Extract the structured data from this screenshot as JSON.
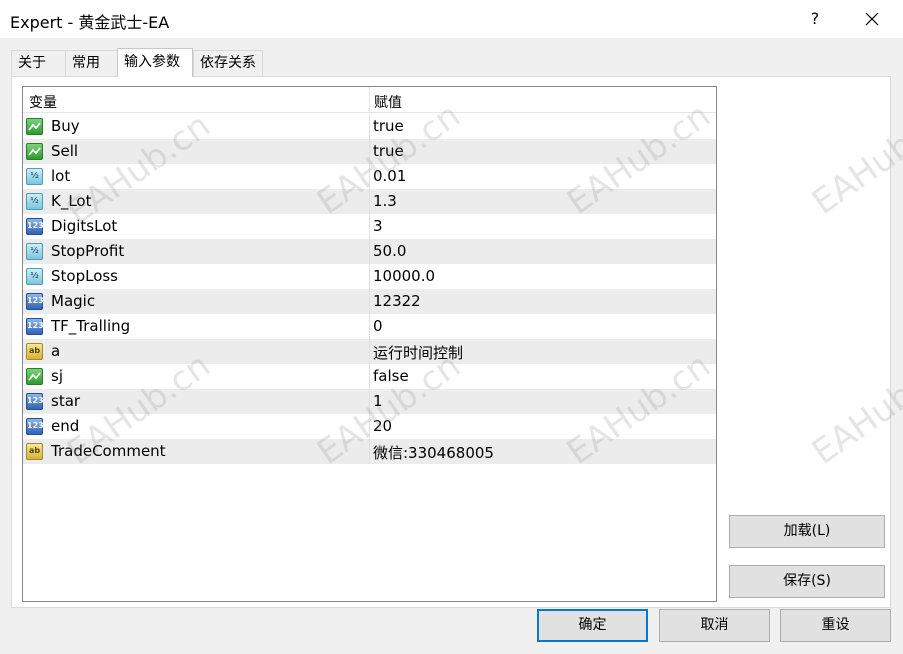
{
  "window": {
    "title": "Expert - 黄金武士-EA",
    "help": "?"
  },
  "tabs": [
    {
      "label": "关于"
    },
    {
      "label": "常用"
    },
    {
      "label": "输入参数"
    },
    {
      "label": "依存关系"
    }
  ],
  "table": {
    "headers": {
      "variable": "变量",
      "value": "赋值"
    },
    "rows": [
      {
        "name": "Buy",
        "value": "true",
        "icon": "bool-icon"
      },
      {
        "name": "Sell",
        "value": "true",
        "icon": "bool-icon"
      },
      {
        "name": "lot",
        "value": "0.01",
        "icon": "double-icon"
      },
      {
        "name": "K_Lot",
        "value": "1.3",
        "icon": "double-icon"
      },
      {
        "name": "DigitsLot",
        "value": "3",
        "icon": "int-icon"
      },
      {
        "name": "StopProfit",
        "value": "50.0",
        "icon": "double-icon"
      },
      {
        "name": "StopLoss",
        "value": "10000.0",
        "icon": "double-icon"
      },
      {
        "name": "Magic",
        "value": "12322",
        "icon": "int-icon"
      },
      {
        "name": "TF_Tralling",
        "value": "0",
        "icon": "int-icon"
      },
      {
        "name": "a",
        "value": "运行时间控制",
        "icon": "string-icon"
      },
      {
        "name": "sj",
        "value": "false",
        "icon": "bool-icon"
      },
      {
        "name": "star",
        "value": "1",
        "icon": "int-icon"
      },
      {
        "name": "end",
        "value": "20",
        "icon": "int-icon"
      },
      {
        "name": "TradeComment",
        "value": "微信:330468005",
        "icon": "string-icon"
      }
    ]
  },
  "icon_glyphs": {
    "double": "½",
    "int": "123",
    "string": "ab"
  },
  "buttons": {
    "load": "加载(L)",
    "save": "保存(S)",
    "ok": "确定",
    "cancel": "取消",
    "reset": "重设"
  },
  "watermark": "EAHub.cn"
}
